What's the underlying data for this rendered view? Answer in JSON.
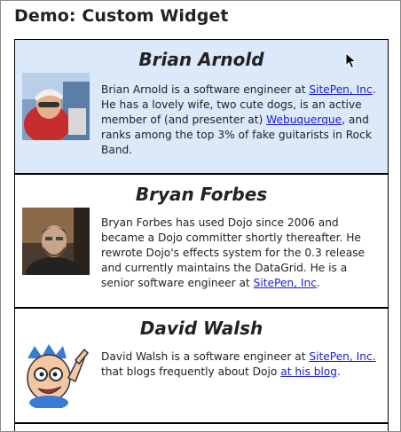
{
  "page": {
    "title": "Demo: Custom Widget"
  },
  "people": [
    {
      "name": "Brian Arnold",
      "bio": [
        {
          "t": "Brian Arnold is a software engineer at "
        },
        {
          "t": "SitePen, Inc",
          "link": true
        },
        {
          "t": ". He has a lovely wife, two cute dogs, is an active member of (and presenter at) "
        },
        {
          "t": "Webuquerque",
          "link": true
        },
        {
          "t": ", and ranks among the top 3% of fake guitarists in Rock Band."
        }
      ]
    },
    {
      "name": "Bryan Forbes",
      "bio": [
        {
          "t": "Bryan Forbes has used Dojo since 2006 and became a Dojo committer shortly thereafter. He rewrote Dojo's effects system for the 0.3 release and currently maintains the DataGrid. He is a senior software engineer at "
        },
        {
          "t": "SitePen, Inc",
          "link": true
        },
        {
          "t": "."
        }
      ]
    },
    {
      "name": "David Walsh",
      "bio": [
        {
          "t": "David Walsh is a software engineer at "
        },
        {
          "t": "SitePen, Inc.",
          "link": true
        },
        {
          "t": " that blogs frequently about Dojo "
        },
        {
          "t": "at his blog",
          "link": true
        },
        {
          "t": "."
        }
      ]
    }
  ],
  "colors": {
    "selected_card": "#dbe9fb",
    "link": "#1a1ae6"
  }
}
